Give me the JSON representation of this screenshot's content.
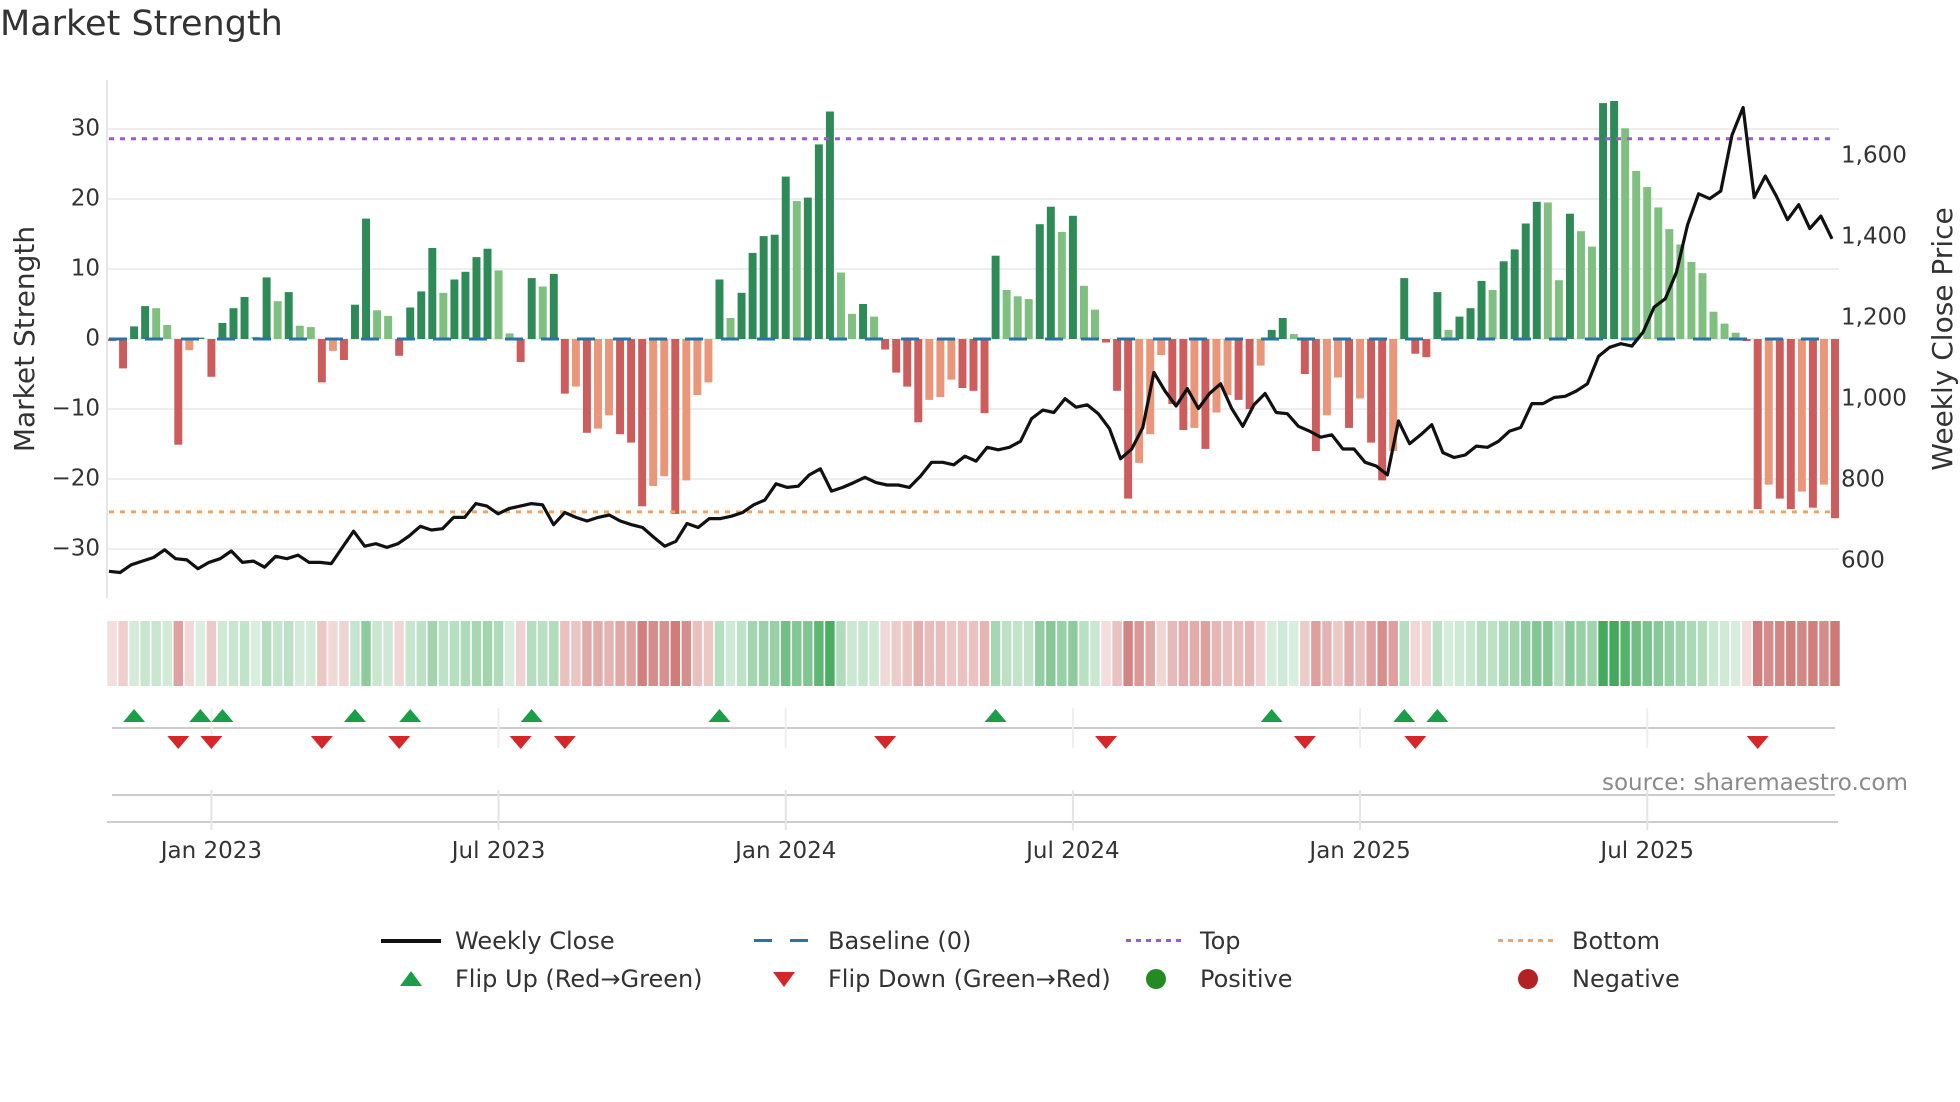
{
  "title": "Market Strength",
  "source": "source: sharemaestro.com",
  "legend": {
    "weekly_close": "Weekly Close",
    "baseline": "Baseline (0)",
    "top": "Top",
    "bottom": "Bottom",
    "flip_up": "Flip Up (Red→Green)",
    "flip_down": "Flip Down (Green→Red)",
    "positive": "Positive",
    "negative": "Negative"
  },
  "colors": {
    "pos_rising": "#2e8b57",
    "pos_falling": "#7fbf7f",
    "neg_falling": "#cd5c5c",
    "neg_rising": "#e9967a",
    "price_line": "#111111",
    "baseline": "#2874a6",
    "top": "#9b59d6",
    "bottom": "#f4a460",
    "flip_up": "#1a9e48",
    "flip_down": "#d62728",
    "positive": "#228b22",
    "negative": "#b22222"
  },
  "chart_data": {
    "type": "bar+line",
    "title": "Market Strength",
    "ylabel": "Market Strength",
    "y2label": "Weekly Close Price",
    "ylim": [
      -37,
      37
    ],
    "y2lim": [
      509,
      1788
    ],
    "yticks": [
      30,
      20,
      10,
      0,
      -10,
      -20,
      -30
    ],
    "ytick_labels": [
      "30",
      "20",
      "10",
      "0",
      "−10",
      "−20",
      "−30"
    ],
    "y2ticks": [
      600,
      800,
      1000,
      1200,
      1400,
      1600
    ],
    "y2tick_labels": [
      "600",
      "800",
      "1,000",
      "1,200",
      "1,400",
      "1,600"
    ],
    "xtick_labels": [
      "Jan 2023",
      "Jul 2023",
      "Jan 2024",
      "Jul 2024",
      "Jan 2025",
      "Jul 2025"
    ],
    "xtick_week_index": [
      9,
      35,
      61,
      87,
      113,
      139
    ],
    "top_level": 28.6,
    "bottom_level": -24.7,
    "baseline": 0,
    "strength": [
      -0.3,
      -4.2,
      1.8,
      4.7,
      4.4,
      2,
      -15.1,
      -1.6,
      0.2,
      -5.4,
      2.3,
      4.4,
      6,
      0.3,
      8.8,
      5.4,
      6.7,
      1.9,
      1.7,
      -6.2,
      -1.7,
      -3,
      4.9,
      17.2,
      4.1,
      3.3,
      -2.4,
      4.5,
      6.8,
      13,
      6.6,
      8.5,
      9.6,
      11.7,
      12.9,
      9.8,
      0.8,
      -3.3,
      8.7,
      7.5,
      9.3,
      -7.8,
      -6.8,
      -13.4,
      -12.8,
      -10.9,
      -13.6,
      -14.8,
      -23.9,
      -21,
      -19.6,
      -25,
      -20.2,
      -8,
      -6.2,
      8.5,
      3,
      6.6,
      12.3,
      14.7,
      14.9,
      23.2,
      19.7,
      20.2,
      27.8,
      32.5,
      9.5,
      3.6,
      5,
      3.2,
      -1.5,
      -4.8,
      -6.8,
      -11.9,
      -8.7,
      -8.3,
      -5.8,
      -7,
      -7.4,
      -10.6,
      11.9,
      7,
      6.1,
      5.7,
      16.4,
      18.9,
      15.3,
      17.6,
      7.6,
      4.2,
      -0.5,
      -7.4,
      -22.8,
      -17.7,
      -13.6,
      -2.3,
      -9.3,
      -13,
      -12.7,
      -15.7,
      -10.5,
      -8,
      -8.7,
      -10,
      -3.8,
      1.3,
      3,
      0.7,
      -5,
      -16,
      -10.9,
      -5.5,
      -12.7,
      -8.5,
      -14.8,
      -20.2,
      -16,
      8.7,
      -2.1,
      -2.6,
      6.7,
      1.3,
      3.2,
      4.4,
      8.3,
      7,
      11.1,
      12.8,
      16.5,
      19.6,
      19.5,
      8.4,
      17.9,
      15.4,
      13.2,
      33.7,
      34,
      30.1,
      24,
      21.7,
      18.8,
      15.7,
      13.5,
      11,
      9.4,
      3.9,
      2.2,
      0.9,
      -0.3,
      -24.3,
      -20.8,
      -22.8,
      -24.3,
      -21.8,
      -24.1,
      -20.8,
      -25.6
    ],
    "weekly_close": [
      575,
      572,
      591,
      600,
      609,
      628,
      606,
      603,
      581,
      597,
      606,
      625,
      597,
      600,
      585,
      612,
      606,
      615,
      597,
      597,
      594,
      634,
      674,
      637,
      643,
      634,
      643,
      662,
      686,
      677,
      680,
      708,
      708,
      742,
      736,
      717,
      730,
      736,
      742,
      739,
      690,
      720,
      708,
      699,
      708,
      714,
      699,
      690,
      683,
      659,
      637,
      649,
      693,
      683,
      705,
      705,
      711,
      720,
      739,
      751,
      791,
      782,
      785,
      813,
      828,
      773,
      782,
      794,
      807,
      794,
      788,
      788,
      782,
      810,
      844,
      844,
      838,
      859,
      847,
      881,
      875,
      881,
      896,
      952,
      973,
      967,
      1001,
      980,
      986,
      964,
      927,
      853,
      877,
      930,
      1066,
      1020,
      983,
      1026,
      977,
      1014,
      1038,
      977,
      933,
      986,
      1014,
      967,
      964,
      933,
      921,
      906,
      912,
      877,
      877,
      844,
      835,
      813,
      946,
      890,
      912,
      937,
      868,
      856,
      862,
      884,
      881,
      896,
      921,
      930,
      989,
      989,
      1004,
      1007,
      1020,
      1038,
      1106,
      1128,
      1137,
      1131,
      1165,
      1227,
      1248,
      1313,
      1430,
      1507,
      1495,
      1514,
      1652,
      1720,
      1498,
      1551,
      1501,
      1443,
      1480,
      1421,
      1452,
      1396
    ],
    "flip_up_index": [
      2,
      8,
      10,
      22,
      27,
      38,
      55,
      80,
      105,
      117,
      120
    ],
    "flip_down_index": [
      6,
      9,
      19,
      26,
      37,
      41,
      70,
      90,
      108,
      118,
      149
    ],
    "grid": true,
    "legend_position": "bottom"
  }
}
